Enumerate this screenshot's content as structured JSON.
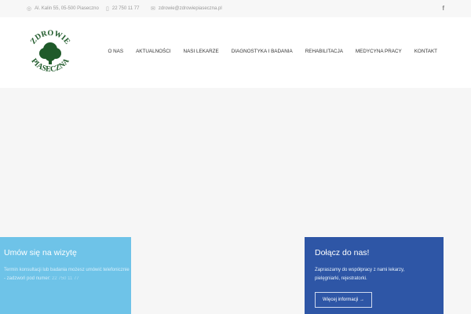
{
  "topbar": {
    "address": "Al. Kalin 55, 05-500 Piaseczno",
    "phone": "22 750 11 77",
    "email": "zdrowie@zdrowiepiaseczna.pl",
    "social": "f"
  },
  "logo": {
    "line1": "ZDROWIE",
    "line2": "PIASECZNA"
  },
  "nav": [
    "O NAS",
    "AKTUALNOŚCI",
    "NASI LEKARZE",
    "DIAGNOSTYKA I BADANIA",
    "REHABILITACJA",
    "MEDYCYNA PRACY",
    "KONTAKT"
  ],
  "card_left": {
    "title": "Umów się na wizytę",
    "text": "Termin konsultacji lub badania możesz umówić telefonicznie - zadzwoń pod numer:",
    "phone": "22 750 11 77"
  },
  "card_right": {
    "title": "Dołącz do nas!",
    "text": "Zapraszamy do współpracy z nami lekarzy, pielęgniarki, rejestratorki.",
    "button": "Więcej informacji",
    "arrow": "→"
  },
  "colors": {
    "light_blue": "#6ec3e8",
    "dark_blue": "#2e56a6",
    "logo_green": "#1f5a2a"
  }
}
